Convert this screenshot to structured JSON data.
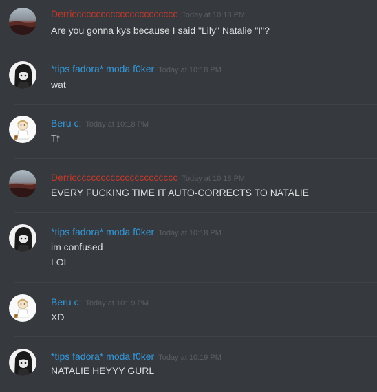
{
  "users": {
    "derric": {
      "name": "Derricccccccccccccccccccccc",
      "color": "#c0392b"
    },
    "tips": {
      "name": "*tips fadora* moda f0ker",
      "color": "#3498db"
    },
    "beru": {
      "name": "Beru c:",
      "color": "#3498db"
    }
  },
  "messages": [
    {
      "user": "derric",
      "timestamp": "Today at 10:18 PM",
      "lines": [
        "Are you gonna kys because I said \"Lily\" Natalie \"I\"?"
      ]
    },
    {
      "user": "tips",
      "timestamp": "Today at 10:18 PM",
      "lines": [
        "wat"
      ]
    },
    {
      "user": "beru",
      "timestamp": "Today at 10:18 PM",
      "lines": [
        "Tf"
      ]
    },
    {
      "user": "derric",
      "timestamp": "Today at 10:18 PM",
      "lines": [
        "EVERY FUCKING TIME IT AUTO-CORRECTS TO NATALIE"
      ]
    },
    {
      "user": "tips",
      "timestamp": "Today at 10:18 PM",
      "lines": [
        "im confused",
        "LOL"
      ]
    },
    {
      "user": "beru",
      "timestamp": "Today at 10:19 PM",
      "lines": [
        "XD"
      ]
    },
    {
      "user": "tips",
      "timestamp": "Today at 10:19 PM",
      "lines": [
        "NATALIE HEYYY GURL"
      ]
    }
  ]
}
